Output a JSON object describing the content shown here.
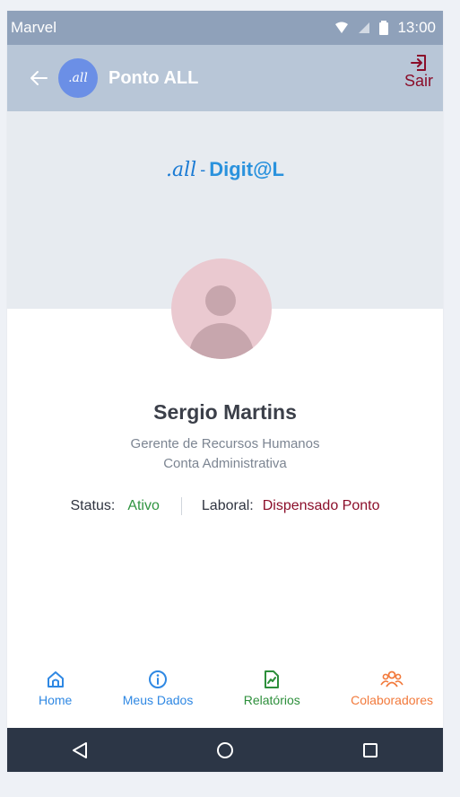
{
  "status_bar": {
    "carrier": "Marvel",
    "time": "13:00",
    "icons": [
      "wifi-icon",
      "signal-icon",
      "battery-icon"
    ]
  },
  "app_bar": {
    "title": "Ponto ALL",
    "logo_text": ".all",
    "logout_label": "Sair"
  },
  "brand": {
    "all": ".all",
    "dash": "-",
    "digital": "Digit@L"
  },
  "profile": {
    "name": "Sergio Martins",
    "role": "Gerente de Recursos Humanos",
    "account": "Conta Administrativa",
    "status_key": "Status:",
    "status_value": "Ativo",
    "labor_key": "Laboral:",
    "labor_value": "Dispensado Ponto"
  },
  "bottom_nav": {
    "items": [
      {
        "label": "Home",
        "icon": "home-icon"
      },
      {
        "label": "Meus Dados",
        "icon": "info-icon"
      },
      {
        "label": "Relatórios",
        "icon": "report-icon"
      },
      {
        "label": "Colaboradores",
        "icon": "users-icon"
      }
    ]
  },
  "colors": {
    "status_bar": "#8fa1ba",
    "app_bar": "#b8c6d7",
    "cover": "#e7ebf0",
    "blue": "#2f88e3",
    "green": "#2d8f3b",
    "orange": "#f27a3c",
    "maroon": "#8b0e2a",
    "android_nav": "#2c3646"
  }
}
